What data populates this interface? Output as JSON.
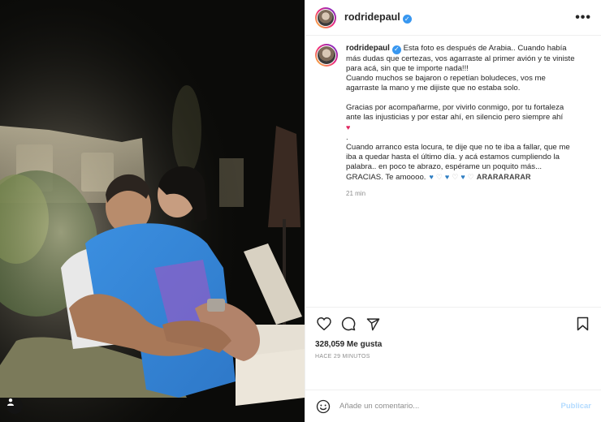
{
  "post": {
    "username": "rodridepaul",
    "caption_lines_1": [
      "Esta foto es después de Arabia.. Cuando había",
      "más dudas que certezas, vos agarraste al primer avión y te viniste",
      "para acá, sin que te importe nada!!!",
      "Cuando muchos se bajaron o repetían boludeces, vos me",
      "agarraste la mano y me dijiste que no estaba solo."
    ],
    "caption_lines_2": [
      "Gracias por acompañarme, por vivirlo conmigo, por tu fortaleza",
      "ante las injusticias y por estar ahí, en silencio pero siempre ahí"
    ],
    "caption_lines_3": [
      "Cuando arranco esta locura, te dije que no te iba a fallar, que me",
      "iba a quedar hasta el último día. y acá estamos cumpliendo la",
      "palabra.. en poco te abrazo, espérame un poquito más...",
      "GRACIAS. Te amoooo."
    ],
    "caption_end": "ARARARARAR",
    "comment_time": "21 min",
    "likes": "328,059 Me gusta",
    "posted_ago": "HACE 29 MINUTOS",
    "comment_placeholder": "Añade un comentario...",
    "publish_label": "Publicar",
    "more_label": "•••"
  },
  "colors": {
    "verified_blue": "#3897f0",
    "publish_disabled": "#b3dbff",
    "heart_blue": "#2f7ec2"
  },
  "icons": [
    "heart-icon",
    "comment-icon",
    "share-icon",
    "bookmark-icon",
    "emoji-icon",
    "user-tag-icon",
    "more-icon",
    "verified-icon"
  ]
}
